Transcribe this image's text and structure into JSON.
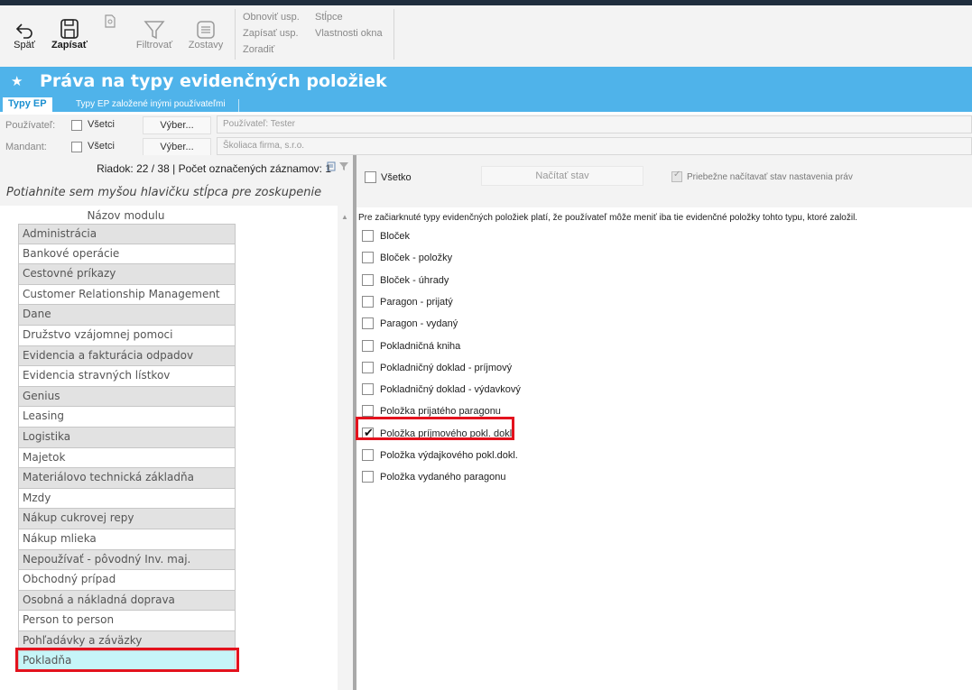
{
  "colors": {
    "accent": "#4fb3ea",
    "highlight": "#e3121d",
    "selected_row": "#c6f5f8"
  },
  "toolbar": {
    "back_label": "Späť",
    "save_label": "Zapísať",
    "filter_label": "Filtrovať",
    "reports_label": "Zostavy",
    "restore_label": "Obnoviť usp.",
    "write_label": "Zapísať usp.",
    "sort_label": "Zoradiť",
    "columns_label": "Stĺpce",
    "window_props_label": "Vlastnosti okna"
  },
  "page": {
    "title": "Práva na typy evidenčných položiek"
  },
  "tabs": [
    {
      "label": "Typy EP"
    },
    {
      "label": "Typy EP založené inými používateľmi"
    }
  ],
  "filters": {
    "user": {
      "label": "Používateľ:",
      "all_label": "Všetci",
      "select_label": "Výber...",
      "value": "Používateľ: Tester"
    },
    "mandant": {
      "label": "Mandant:",
      "all_label": "Všetci",
      "select_label": "Výber...",
      "value": "Školiaca firma, s.r.o."
    }
  },
  "left": {
    "status": "Riadok: 22 / 38 | Počet označených záznamov: 1",
    "group_hint": "Potiahnite sem myšou hlavičku stĺpca pre zoskupenie",
    "column_header": "Názov modulu",
    "modules": [
      "Administrácia",
      "Bankové operácie",
      "Cestovné príkazy",
      "Customer Relationship Management",
      "Dane",
      "Družstvo vzájomnej pomoci",
      "Evidencia a fakturácia odpadov",
      "Evidencia stravných lístkov",
      "Genius",
      "Leasing",
      "Logistika",
      "Majetok",
      "Materiálovo technická základňa",
      "Mzdy",
      "Nákup cukrovej repy",
      "Nákup mlieka",
      "Nepoužívať - pôvodný Inv. maj.",
      "Obchodný prípad",
      "Osobná a nákladná doprava",
      "Person to person",
      "Pohľadávky a záväzky",
      "Pokladňa"
    ],
    "selected_index": 21
  },
  "right": {
    "all_label": "Všetko",
    "load_button": "Načítať stav",
    "live_load_label": "Priebežne načítavať stav nastavenia práv",
    "note": "Pre začiarknuté typy evidenčných položiek platí, že používateľ môže meniť iba tie evidenčné položky tohto typu, ktoré založil.",
    "items": [
      {
        "label": "Bloček",
        "checked": false
      },
      {
        "label": "Bloček - položky",
        "checked": false
      },
      {
        "label": "Bloček - úhrady",
        "checked": false
      },
      {
        "label": "Paragon - prijatý",
        "checked": false
      },
      {
        "label": "Paragon - vydaný",
        "checked": false
      },
      {
        "label": "Pokladničná kniha",
        "checked": false
      },
      {
        "label": "Pokladničný doklad - príjmový",
        "checked": false
      },
      {
        "label": "Pokladničný doklad - výdavkový",
        "checked": false
      },
      {
        "label": "Položka prijatého paragonu",
        "checked": false
      },
      {
        "label": "Položka príjmového pokl. dokl.",
        "checked": true
      },
      {
        "label": "Položka výdajkového pokl.dokl.",
        "checked": false
      },
      {
        "label": "Položka vydaného paragonu",
        "checked": false
      }
    ]
  }
}
